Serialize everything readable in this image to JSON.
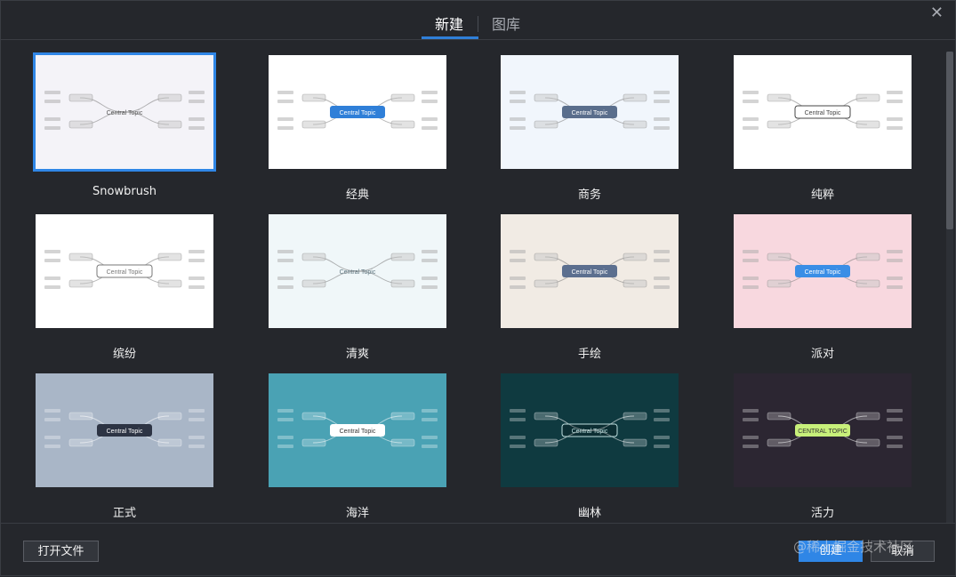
{
  "tabs": [
    {
      "label": "新建",
      "active": true
    },
    {
      "label": "图库",
      "active": false
    }
  ],
  "templates": [
    {
      "name": "Snowbrush",
      "bg": "#f4f3f8",
      "center": "Central Topic",
      "center_style": "text",
      "center_color": "#555555",
      "selected": true
    },
    {
      "name": "经典",
      "bg": "#ffffff",
      "center": "Central Topic",
      "center_style": "fill",
      "center_color": "#2f7fd8"
    },
    {
      "name": "商务",
      "bg": "#f1f6fc",
      "center": "Central Topic",
      "center_style": "fill",
      "center_color": "#5a6e8c"
    },
    {
      "name": "纯粹",
      "bg": "#ffffff",
      "center": "Central Topic",
      "center_style": "outline",
      "center_color": "#444444"
    },
    {
      "name": "缤纷",
      "bg": "#ffffff",
      "center": "Central Topic",
      "center_style": "outline",
      "center_color": "#777777"
    },
    {
      "name": "清爽",
      "bg": "#f0f7f9",
      "center": "Central Topic",
      "center_style": "text",
      "center_color": "#5f7680"
    },
    {
      "name": "手绘",
      "bg": "#f1ebe4",
      "center": "Central Topic",
      "center_style": "fill",
      "center_color": "#5c6f8f"
    },
    {
      "name": "派对",
      "bg": "#f8d8df",
      "center": "Central Topic",
      "center_style": "fill",
      "center_color": "#3a8ee6"
    },
    {
      "name": "正式",
      "bg": "#a9b6c7",
      "center": "Central Topic",
      "center_style": "fill",
      "center_color": "#2d3444"
    },
    {
      "name": "海洋",
      "bg": "#4aa2b4",
      "center": "Central Topic",
      "center_style": "fill",
      "center_color": "#ffffff"
    },
    {
      "name": "幽林",
      "bg": "#0f3a40",
      "center": "Central Topic",
      "center_style": "outline",
      "center_color": "#bfe0e0"
    },
    {
      "name": "活力",
      "bg": "#2c2632",
      "center": "CENTRAL TOPIC",
      "center_style": "fill",
      "center_color": "#c8f07a"
    }
  ],
  "buttons": {
    "open": "打开文件",
    "create": "创建",
    "cancel": "取消"
  },
  "watermark": "@稀土掘金技术社区",
  "colors": {
    "accent": "#2f86e6",
    "background": "#25272c"
  }
}
